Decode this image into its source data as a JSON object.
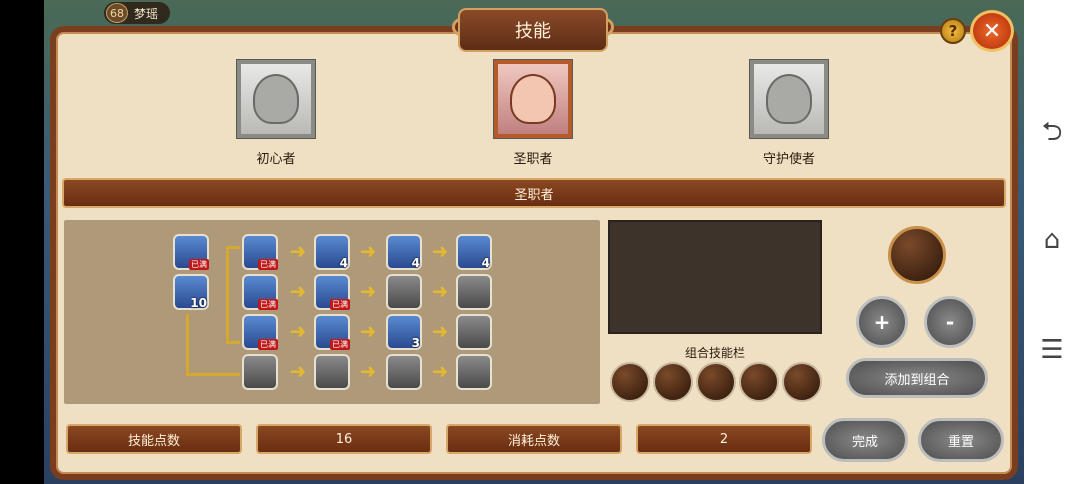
{
  "player": {
    "level": "68",
    "name": "梦瑶"
  },
  "window": {
    "title": "技能",
    "help": "?",
    "close": "✕"
  },
  "jobs": [
    {
      "label": "初心者"
    },
    {
      "label": "圣职者"
    },
    {
      "label": "守护使者"
    }
  ],
  "job_bar": {
    "label": "圣职者"
  },
  "skill_tree": {
    "badge_full": "已满",
    "skills": [
      {
        "id": "s1",
        "badge": "已满"
      },
      {
        "id": "s2",
        "badge": "10"
      },
      {
        "id": "s3",
        "badge": "已满"
      },
      {
        "id": "s4",
        "badge": "4"
      },
      {
        "id": "s5",
        "badge": "4"
      },
      {
        "id": "s6",
        "badge": "4"
      },
      {
        "id": "s7",
        "badge": "已满"
      },
      {
        "id": "s8",
        "badge": "已满"
      },
      {
        "id": "s9",
        "badge": ""
      },
      {
        "id": "s10",
        "badge": ""
      },
      {
        "id": "s11",
        "badge": "已满"
      },
      {
        "id": "s12",
        "badge": "已满"
      },
      {
        "id": "s13",
        "badge": "3"
      },
      {
        "id": "s14",
        "badge": ""
      },
      {
        "id": "s15",
        "badge": ""
      },
      {
        "id": "s16",
        "badge": ""
      },
      {
        "id": "s17",
        "badge": ""
      },
      {
        "id": "s18",
        "badge": ""
      }
    ]
  },
  "combo": {
    "label": "组合技能栏",
    "add_label": "添加到组合"
  },
  "controls": {
    "plus": "+",
    "minus": "-"
  },
  "footer": {
    "skill_points_label": "技能点数",
    "skill_points_value": "16",
    "cost_label": "消耗点数",
    "cost_value": "2",
    "done_label": "完成",
    "reset_label": "重置"
  },
  "nav": {
    "back": "⮌",
    "home": "⌂",
    "menu": "☰"
  }
}
